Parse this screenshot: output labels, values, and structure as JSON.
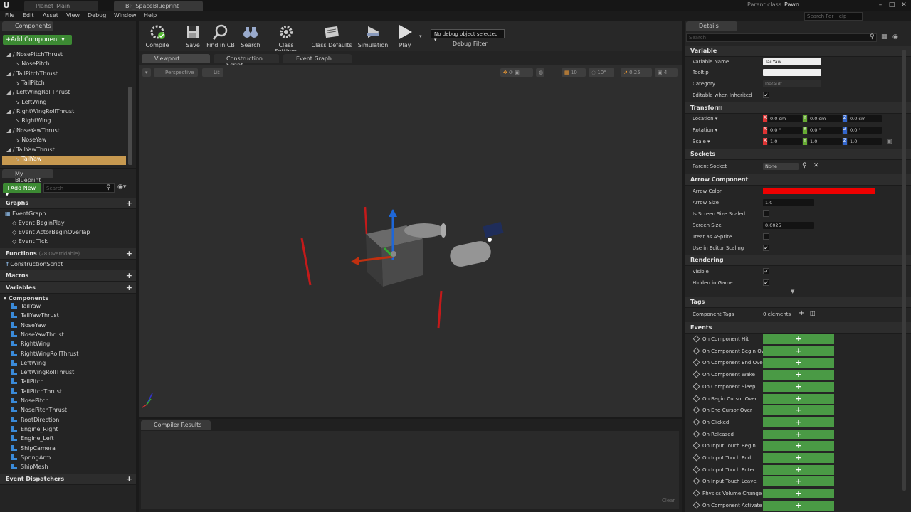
{
  "titlebar": {
    "tabs": [
      "Planet_Main",
      "BP_SpaceBlueprint"
    ],
    "help_search_placeholder": "Search For Help"
  },
  "menubar": {
    "items": [
      "File",
      "Edit",
      "Asset",
      "View",
      "Debug",
      "Window",
      "Help"
    ],
    "parent_class_label": "Parent class:",
    "parent_class_value": "Pawn"
  },
  "components_panel": {
    "title": "Components",
    "add_button": "+Add Component ▾",
    "tree": [
      {
        "label": "NosePitchThrust",
        "indent": 1
      },
      {
        "label": "NosePitch",
        "indent": 2
      },
      {
        "label": "TailPitchThrust",
        "indent": 1
      },
      {
        "label": "TailPitch",
        "indent": 2
      },
      {
        "label": "LeftWingRollThrust",
        "indent": 1
      },
      {
        "label": "LeftWing",
        "indent": 2
      },
      {
        "label": "RightWingRollThrust",
        "indent": 1
      },
      {
        "label": "RightWing",
        "indent": 2
      },
      {
        "label": "NoseYawThrust",
        "indent": 1
      },
      {
        "label": "NoseYaw",
        "indent": 2
      },
      {
        "label": "TailYawThrust",
        "indent": 1
      },
      {
        "label": "TailYaw",
        "indent": 2,
        "selected": true
      }
    ]
  },
  "my_blueprint": {
    "title": "My Blueprint",
    "add_new": "+Add New ▾",
    "search_placeholder": "Search",
    "sections": {
      "graphs": "Graphs",
      "event_graph": "EventGraph",
      "events": [
        "Event BeginPlay",
        "Event ActorBeginOverlap",
        "Event Tick"
      ],
      "functions": "Functions",
      "functions_overridable": "(28 Overridable)",
      "construction_script": "ConstructionScript",
      "macros": "Macros",
      "variables": "Variables",
      "components": "Components",
      "event_dispatchers": "Event Dispatchers"
    },
    "component_vars": [
      "TailYaw",
      "TailYawThrust",
      "NoseYaw",
      "NoseYawThrust",
      "RightWing",
      "RightWingRollThrust",
      "LeftWing",
      "LeftWingRollThrust",
      "TailPitch",
      "TailPitchThrust",
      "NosePitch",
      "NosePitchThrust",
      "RootDirection",
      "Engine_Right",
      "Engine_Left",
      "ShipCamera",
      "SpringArm",
      "ShipMesh"
    ]
  },
  "toolbar": {
    "compile": "Compile",
    "save": "Save",
    "find_in_cb": "Find in CB",
    "search": "Search",
    "class_settings": "Class Settings",
    "class_defaults": "Class Defaults",
    "simulation": "Simulation",
    "play": "Play",
    "debug_select": "No debug object selected ▾",
    "debug_filter": "Debug Filter"
  },
  "editor_tabs": [
    "Viewport",
    "Construction Script",
    "Event Graph"
  ],
  "viewport": {
    "perspective": "Perspective",
    "lit": "Lit",
    "grid_snap": "10",
    "rot_snap": "10°",
    "scale_snap": "0.25",
    "cam_speed": "4"
  },
  "compiler": {
    "title": "Compiler Results",
    "clear": "Clear"
  },
  "details": {
    "title": "Details",
    "search_placeholder": "Search",
    "variable": {
      "head": "Variable",
      "name_label": "Variable Name",
      "name_value": "TailYaw",
      "tooltip_label": "Tooltip",
      "category_label": "Category",
      "category_value": "Default",
      "editable_label": "Editable when Inherited"
    },
    "transform": {
      "head": "Transform",
      "location_label": "Location ▾",
      "rotation_label": "Rotation ▾",
      "scale_label": "Scale ▾",
      "location": [
        "0.0 cm",
        "0.0 cm",
        "0.0 cm"
      ],
      "rotation": [
        "0.0 °",
        "0.0 °",
        "0.0 °"
      ],
      "scale": [
        "1.0",
        "1.0",
        "1.0"
      ]
    },
    "sockets": {
      "head": "Sockets",
      "parent_label": "Parent Socket",
      "parent_value": "None"
    },
    "arrow": {
      "head": "Arrow Component",
      "color_label": "Arrow Color",
      "color_value": "#ee0000",
      "size_label": "Arrow Size",
      "size_value": "1.0",
      "screen_size_scaled_label": "Is Screen Size Scaled",
      "screen_size_label": "Screen Size",
      "screen_size_value": "0.0025",
      "treat_sprite_label": "Treat as ASprite",
      "editor_scaling_label": "Use in Editor Scaling"
    },
    "rendering": {
      "head": "Rendering",
      "visible_label": "Visible",
      "hidden_label": "Hidden in Game"
    },
    "tags": {
      "head": "Tags",
      "component_tags_label": "Component Tags",
      "component_tags_value": "0 elements"
    },
    "events": {
      "head": "Events",
      "items": [
        "On Component Hit",
        "On Component Begin Ov",
        "On Component End Over",
        "On Component Wake",
        "On Component Sleep",
        "On Begin Cursor Over",
        "On End Cursor Over",
        "On Clicked",
        "On Released",
        "On Input Touch Begin",
        "On Input Touch End",
        "On Input Touch Enter",
        "On Input Touch Leave",
        "Physics Volume Change",
        "On Component Activate"
      ]
    }
  }
}
